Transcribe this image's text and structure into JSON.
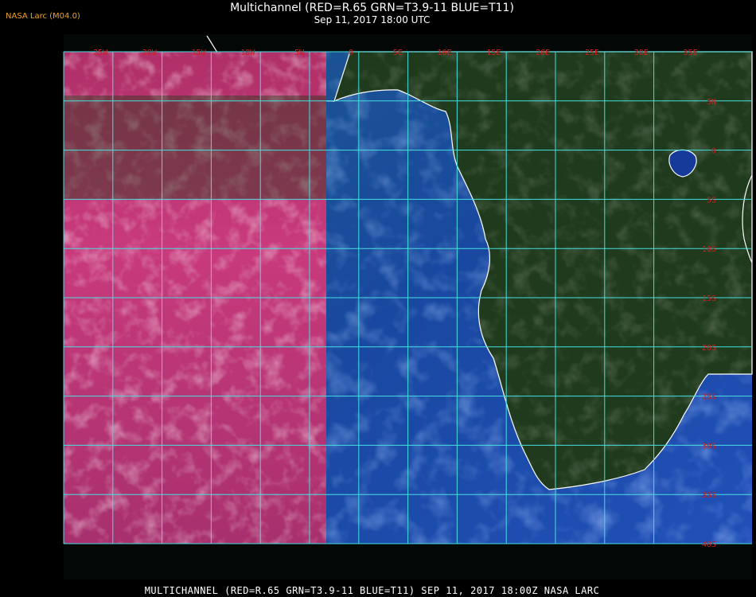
{
  "header": {
    "credit": "NASA Larc (M04.0)",
    "title": "Multichannel (RED=R.65 GRN=T3.9-11 BLUE=T11)",
    "subtitle": "Sep 11, 2017 18:00 UTC"
  },
  "footer": {
    "caption": "MULTICHANNEL (RED=R.65 GRN=T3.9-11 BLUE=T11) SEP 11, 2017 18:00Z   NASA LARC"
  },
  "map": {
    "longitude_labels": [
      "25W",
      "20W",
      "15W",
      "10W",
      "5W",
      "0",
      "5E",
      "10E",
      "15E",
      "20E",
      "25E",
      "30E",
      "35E"
    ],
    "latitude_labels": [
      "5N",
      "0",
      "5S",
      "10S",
      "15S",
      "20S",
      "25S",
      "30S",
      "35S",
      "40S"
    ],
    "colors": {
      "grid": "#44e0e0",
      "label": "#d21e1e",
      "coast": "#ffffff",
      "west_sector": "#c23a7a",
      "east_sector": "#1e4a9a",
      "land": "#1f3a1c"
    }
  }
}
